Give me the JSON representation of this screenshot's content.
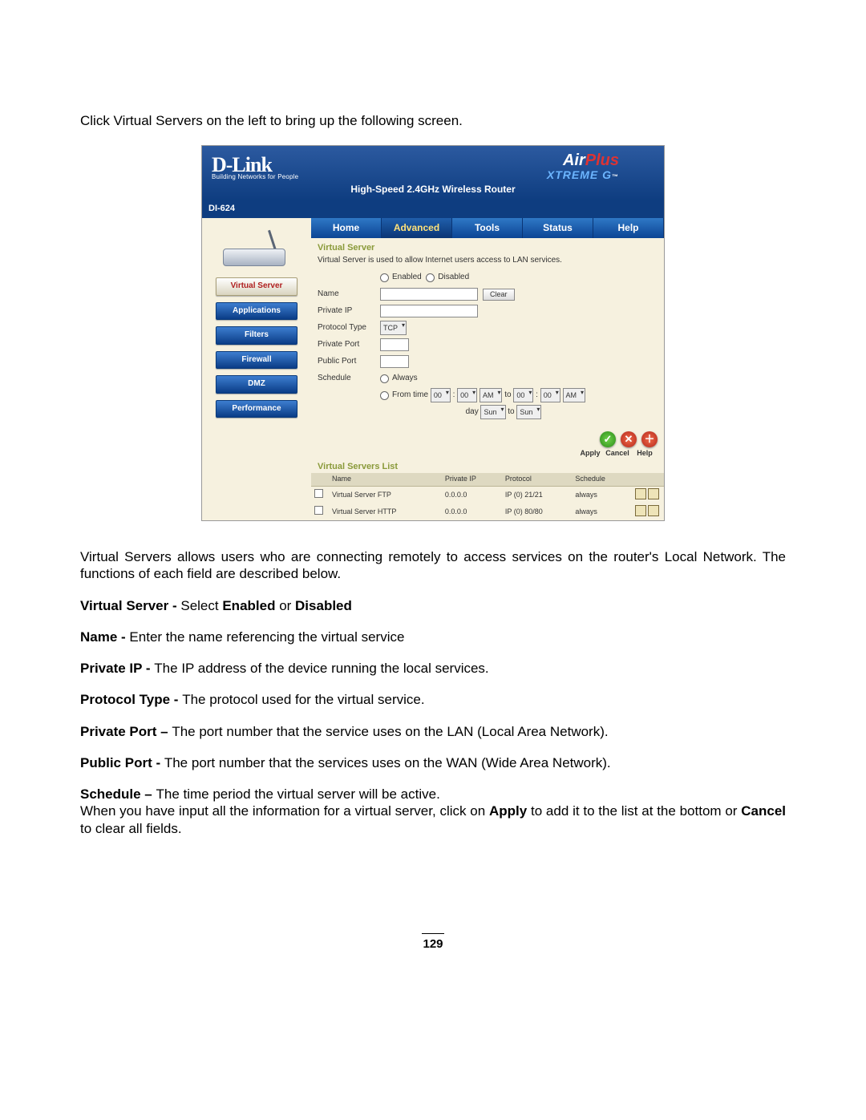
{
  "intro": "Click Virtual Servers on the left to bring up the following screen.",
  "router": {
    "brand": "D-Link",
    "brand_tag": "Building Networks for People",
    "product1": "Air",
    "product2": "Plus",
    "product3": "XTREME G",
    "tm": "™",
    "subtitle": "High-Speed 2.4GHz Wireless Router",
    "model": "DI-624",
    "sidebar": {
      "items": [
        "Virtual Server",
        "Applications",
        "Filters",
        "Firewall",
        "DMZ",
        "Performance"
      ],
      "active_index": 0
    },
    "tabs": {
      "labels": [
        "Home",
        "Advanced",
        "Tools",
        "Status",
        "Help"
      ],
      "active_index": 1
    },
    "form": {
      "section": "Virtual Server",
      "desc": "Virtual Server is used to allow Internet users access to LAN services.",
      "enabled": "Enabled",
      "disabled": "Disabled",
      "name": "Name",
      "clear": "Clear",
      "private_ip": "Private IP",
      "protocol_type": "Protocol Type",
      "protocol_value": "TCP",
      "private_port": "Private Port",
      "public_port": "Public Port",
      "schedule": "Schedule",
      "always": "Always",
      "from": "From",
      "time": "time",
      "to": "to",
      "day": "day",
      "zero": "00",
      "am": "AM",
      "sun": "Sun"
    },
    "actions": {
      "apply": "Apply",
      "cancel": "Cancel",
      "help": "Help"
    },
    "list": {
      "title": "Virtual Servers List",
      "headers": [
        "Name",
        "Private IP",
        "Protocol",
        "Schedule"
      ],
      "rows": [
        {
          "name": "Virtual Server FTP",
          "ip": "0.0.0.0",
          "proto": "IP (0) 21/21",
          "sched": "always"
        },
        {
          "name": "Virtual Server HTTP",
          "ip": "0.0.0.0",
          "proto": "IP (0) 80/80",
          "sched": "always"
        }
      ]
    }
  },
  "para2a": "Virtual Servers allows users who are connecting remotely to access services on the router's Local Network. The functions of each field are described below.",
  "fields": {
    "vs_b": "Virtual Server - ",
    "vs_t1": "Select ",
    "vs_en": "Enabled",
    "vs_or": " or ",
    "vs_dis": "Disabled",
    "name_b": "Name - ",
    "name_t": "Enter the name referencing the virtual service",
    "pip_b": "Private IP - ",
    "pip_t": "The IP address of the device running the local services.",
    "pt_b": "Protocol Type - ",
    "pt_t": "The protocol used for the virtual service.",
    "pp_b": "Private Port – ",
    "pp_t": "The port number that the service uses on the LAN (Local Area Network).",
    "pub_b": "Public Port - ",
    "pub_t": "The port number that the services uses on the WAN (Wide Area Network).",
    "sch_b": "Schedule – ",
    "sch_t": "The time period the virtual server will be active.",
    "last1": "When you have input all the information for a virtual server, click on ",
    "last_apply": "Apply",
    "last2": " to add it to the list at the bottom or ",
    "last_cancel": "Cancel",
    "last3": " to clear all fields."
  },
  "page_number": "129"
}
